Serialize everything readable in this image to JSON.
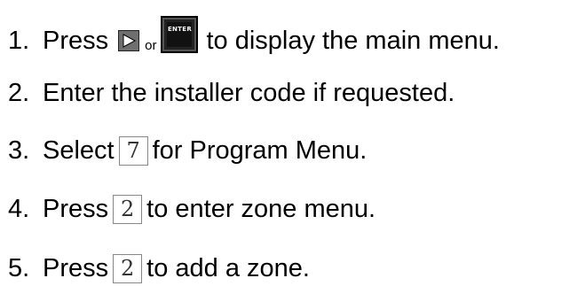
{
  "steps": [
    {
      "number": "1.",
      "text_before": "Press",
      "or_text": "or",
      "enter_key_label": "ENTER",
      "text_after": "to display the main menu."
    },
    {
      "number": "2.",
      "text": "Enter the installer code if requested."
    },
    {
      "number": "3.",
      "text_before": "Select",
      "key": "7",
      "text_after": "for Program Menu."
    },
    {
      "number": "4.",
      "text_before": "Press",
      "key": "2",
      "text_after": "to enter zone menu."
    },
    {
      "number": "5.",
      "text_before": "Press",
      "key": "2",
      "text_after": "to add a zone."
    }
  ],
  "icons": {
    "right_arrow_key": "right-arrow-key-icon",
    "enter_key": "enter-key-icon"
  },
  "colors": {
    "text": "#000000",
    "arrow_key_bg": "#6f6f6f",
    "enter_key_bg": "#111111"
  }
}
